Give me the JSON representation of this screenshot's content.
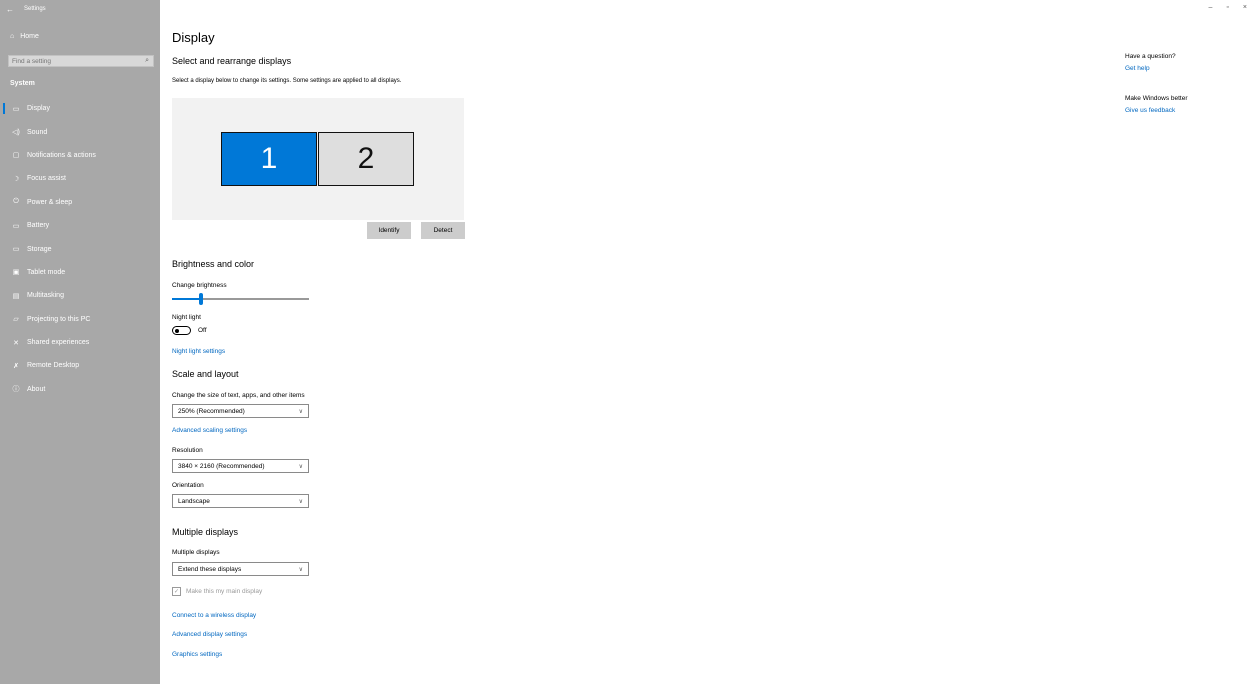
{
  "window": {
    "app_title": "Settings",
    "back_glyph": "←",
    "controls": {
      "minimize": "–",
      "restore": "▫",
      "close": "×"
    }
  },
  "sidebar": {
    "home": {
      "label": "Home",
      "icon": "home-icon",
      "glyph": "⌂"
    },
    "search": {
      "placeholder": "Find a setting",
      "value": "",
      "icon_glyph": "⌕"
    },
    "section_label": "System",
    "items": [
      {
        "label": "Display",
        "icon": "display-icon",
        "glyph": "▭",
        "active": true
      },
      {
        "label": "Sound",
        "icon": "sound-icon",
        "glyph": "◁)"
      },
      {
        "label": "Notifications & actions",
        "icon": "notifications-icon",
        "glyph": "▢"
      },
      {
        "label": "Focus assist",
        "icon": "focus-assist-icon",
        "glyph": "☽"
      },
      {
        "label": "Power & sleep",
        "icon": "power-icon",
        "glyph": "⏻"
      },
      {
        "label": "Battery",
        "icon": "battery-icon",
        "glyph": "▭"
      },
      {
        "label": "Storage",
        "icon": "storage-icon",
        "glyph": "▭"
      },
      {
        "label": "Tablet mode",
        "icon": "tablet-mode-icon",
        "glyph": "▣"
      },
      {
        "label": "Multitasking",
        "icon": "multitasking-icon",
        "glyph": "▤"
      },
      {
        "label": "Projecting to this PC",
        "icon": "projecting-icon",
        "glyph": "▱"
      },
      {
        "label": "Shared experiences",
        "icon": "shared-experiences-icon",
        "glyph": "✕"
      },
      {
        "label": "Remote Desktop",
        "icon": "remote-desktop-icon",
        "glyph": "✗"
      },
      {
        "label": "About",
        "icon": "about-icon",
        "glyph": "ⓘ"
      }
    ]
  },
  "main": {
    "title": "Display",
    "rearrange": {
      "heading": "Select and rearrange displays",
      "description": "Select a display below to change its settings. Some settings are applied to all displays.",
      "monitors": [
        "1",
        "2"
      ],
      "identify_label": "Identify",
      "detect_label": "Detect"
    },
    "brightness": {
      "heading": "Brightness and color",
      "change_brightness_label": "Change brightness",
      "brightness_level_percent": 21,
      "night_light_label": "Night light",
      "night_light_state": "Off",
      "night_light_settings_link": "Night light settings"
    },
    "scale": {
      "heading": "Scale and layout",
      "size_label": "Change the size of text, apps, and other items",
      "size_value": "250% (Recommended)",
      "advanced_scaling_link": "Advanced scaling settings",
      "resolution_label": "Resolution",
      "resolution_value": "3840 × 2160 (Recommended)",
      "orientation_label": "Orientation",
      "orientation_value": "Landscape"
    },
    "multiple": {
      "heading": "Multiple displays",
      "label": "Multiple displays",
      "value": "Extend these displays",
      "main_display_checkbox": "Make this my main display",
      "main_display_checked": true,
      "connect_wireless_link": "Connect to a wireless display",
      "advanced_display_link": "Advanced display settings",
      "graphics_link": "Graphics settings"
    },
    "chevron_glyph": "∨"
  },
  "right_panel": {
    "question_title": "Have a question?",
    "get_help_link": "Get help",
    "better_title": "Make Windows better",
    "feedback_link": "Give us feedback"
  },
  "colors": {
    "accent": "#0078d7",
    "link": "#0067c0",
    "sidebar_bg": "#a8a8a8"
  }
}
